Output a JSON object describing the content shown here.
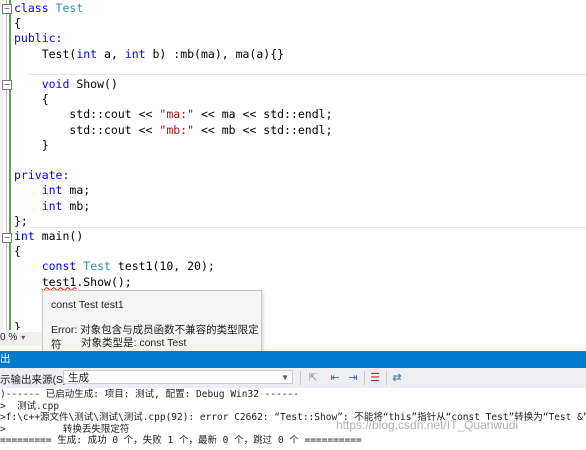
{
  "editor": {
    "lines": [
      {
        "segs": [
          {
            "t": "class ",
            "c": "kw"
          },
          {
            "t": "Test",
            "c": "ty"
          }
        ]
      },
      {
        "segs": [
          {
            "t": "{",
            "c": ""
          }
        ]
      },
      {
        "segs": [
          {
            "t": "public:",
            "c": "kw"
          }
        ]
      },
      {
        "segs": [
          {
            "t": "    Test(",
            "c": ""
          },
          {
            "t": "int",
            "c": "kw"
          },
          {
            "t": " a, ",
            "c": ""
          },
          {
            "t": "int",
            "c": "kw"
          },
          {
            "t": " b) :mb(ma), ma(a){}",
            "c": ""
          }
        ]
      },
      {
        "segs": [
          {
            "t": "",
            "c": ""
          }
        ]
      },
      {
        "segs": [
          {
            "t": "    ",
            "c": ""
          },
          {
            "t": "void",
            "c": "kw"
          },
          {
            "t": " Show()",
            "c": ""
          }
        ]
      },
      {
        "segs": [
          {
            "t": "    {",
            "c": ""
          }
        ]
      },
      {
        "segs": [
          {
            "t": "        std::cout << ",
            "c": ""
          },
          {
            "t": "\"ma:\"",
            "c": "str"
          },
          {
            "t": " << ma << std::endl;",
            "c": ""
          }
        ]
      },
      {
        "segs": [
          {
            "t": "        std::cout << ",
            "c": ""
          },
          {
            "t": "\"mb:\"",
            "c": "str"
          },
          {
            "t": " << mb << std::endl;",
            "c": ""
          }
        ]
      },
      {
        "segs": [
          {
            "t": "    }",
            "c": ""
          }
        ]
      },
      {
        "segs": [
          {
            "t": "",
            "c": ""
          }
        ]
      },
      {
        "segs": [
          {
            "t": "private:",
            "c": "kw"
          }
        ]
      },
      {
        "segs": [
          {
            "t": "    ",
            "c": ""
          },
          {
            "t": "int",
            "c": "kw"
          },
          {
            "t": " ma;",
            "c": ""
          }
        ]
      },
      {
        "segs": [
          {
            "t": "    ",
            "c": ""
          },
          {
            "t": "int",
            "c": "kw"
          },
          {
            "t": " mb;",
            "c": ""
          }
        ]
      },
      {
        "segs": [
          {
            "t": "};",
            "c": ""
          }
        ]
      },
      {
        "segs": [
          {
            "t": "int",
            "c": "kw"
          },
          {
            "t": " main()",
            "c": ""
          }
        ]
      },
      {
        "segs": [
          {
            "t": "{",
            "c": ""
          }
        ]
      },
      {
        "segs": [
          {
            "t": "    ",
            "c": ""
          },
          {
            "t": "const",
            "c": "kw"
          },
          {
            "t": " ",
            "c": ""
          },
          {
            "t": "Test",
            "c": "ty"
          },
          {
            "t": " test1(10, 20);",
            "c": ""
          }
        ]
      },
      {
        "segs": [
          {
            "t": "    ",
            "c": ""
          },
          {
            "t": "test1",
            "c": "err"
          },
          {
            "t": ".Show();",
            "c": ""
          }
        ]
      },
      {
        "segs": [
          {
            "t": "",
            "c": ""
          }
        ]
      },
      {
        "segs": [
          {
            "t": "",
            "c": ""
          }
        ]
      },
      {
        "segs": [
          {
            "t": "}",
            "c": ""
          }
        ]
      }
    ]
  },
  "tooltip": {
    "title": "const Test test1",
    "error_line1": "Error: 对象包含与成员函数不兼容的类型限定符",
    "error_line2": "对象类型是: const Test"
  },
  "zoom": {
    "value": "0 %"
  },
  "output_panel": {
    "title": "出",
    "source_label": "示输出来源(S):",
    "source_value": "生成",
    "lines": [
      ")------ 已启动生成: 项目: 测试, 配置: Debug Win32 ------",
      ">  测试.cpp",
      ">f:\\c++源文件\\测试\\测试\\测试.cpp(92): error C2662: “Test::Show”: 不能将“this”指针从“const Test”转换为“Test &”",
      ">          转换丢失限定符",
      "========= 生成: 成功 0 个，失败 1 个，最新 0 个，跳过 0 个 =========="
    ]
  },
  "watermark": "https://blog.csdn.net/IT_Quanwudi",
  "colors": {
    "accent": "#007acc",
    "keyword": "#0000ff",
    "type": "#2b91af",
    "string": "#a31515",
    "error": "#e51400",
    "change_bar": "#57a64a"
  },
  "icons": [
    "collapse-icon",
    "dropdown-chevron-icon",
    "find-message-icon",
    "prev-message-icon",
    "next-message-icon",
    "clear-all-icon",
    "word-wrap-icon"
  ]
}
